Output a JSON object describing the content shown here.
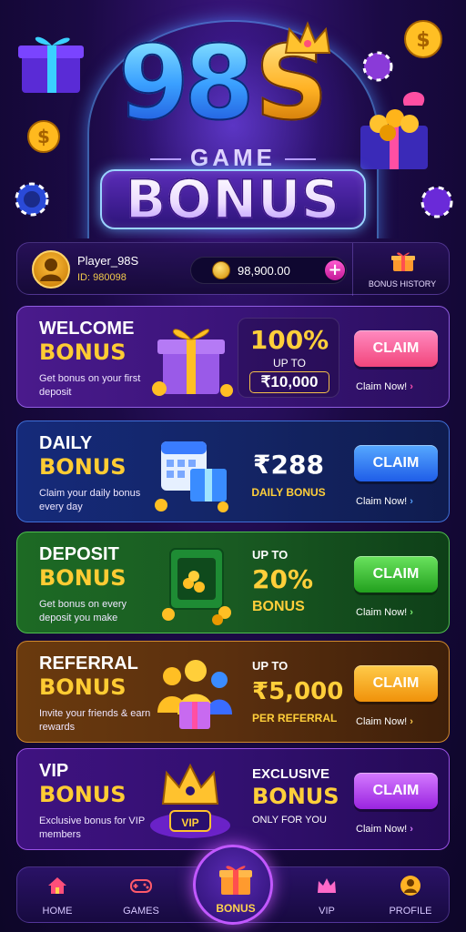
{
  "hero": {
    "logo_left": "98",
    "logo_right": "S",
    "subtitle": "GAME",
    "title": "BONUS"
  },
  "user": {
    "name": "Player_98S",
    "id": "ID: 980098",
    "balance": "98,900.00",
    "add_icon": "plus-icon",
    "history_label": "BONUS HISTORY"
  },
  "cards": [
    {
      "line1": "WELCOME",
      "line2": "BONUS",
      "desc": "Get bonus on your first deposit",
      "mid_top": "100%",
      "mid_sub": "UP TO",
      "mid_amount": "₹10,000",
      "claim": "CLAIM",
      "claim_now": "Claim Now!",
      "color": "#ff5aa0"
    },
    {
      "line1": "DAILY",
      "line2": "BONUS",
      "desc": "Claim your daily bonus every day",
      "mid_top": "₹288",
      "mid_sub": "DAILY BONUS",
      "claim": "CLAIM",
      "claim_now": "Claim Now!",
      "color": "#2f7dff"
    },
    {
      "line1": "DEPOSIT",
      "line2": "BONUS",
      "desc": "Get bonus on every deposit you make",
      "mid_pre": "UP TO",
      "mid_top": "20%",
      "mid_sub": "BONUS",
      "claim": "CLAIM",
      "claim_now": "Claim Now!",
      "color": "#3fc63a"
    },
    {
      "line1": "REFERRAL",
      "line2": "BONUS",
      "desc": "Invite your friends & earn rewards",
      "mid_pre": "UP TO",
      "mid_top": "₹5,000",
      "mid_sub": "PER REFERRAL",
      "claim": "CLAIM",
      "claim_now": "Claim Now!",
      "color": "#f5a623"
    },
    {
      "line1": "VIP",
      "line2": "BONUS",
      "desc": "Exclusive bonus for VIP members",
      "mid_pre": "EXCLUSIVE",
      "mid_top": "BONUS",
      "mid_sub": "ONLY FOR YOU",
      "badge": "VIP",
      "claim": "CLAIM",
      "claim_now": "Claim Now!",
      "color": "#b23cf0"
    }
  ],
  "nav": {
    "home": "HOME",
    "games": "GAMES",
    "bonus": "BONUS",
    "vip": "VIP",
    "profile": "PROFILE"
  }
}
